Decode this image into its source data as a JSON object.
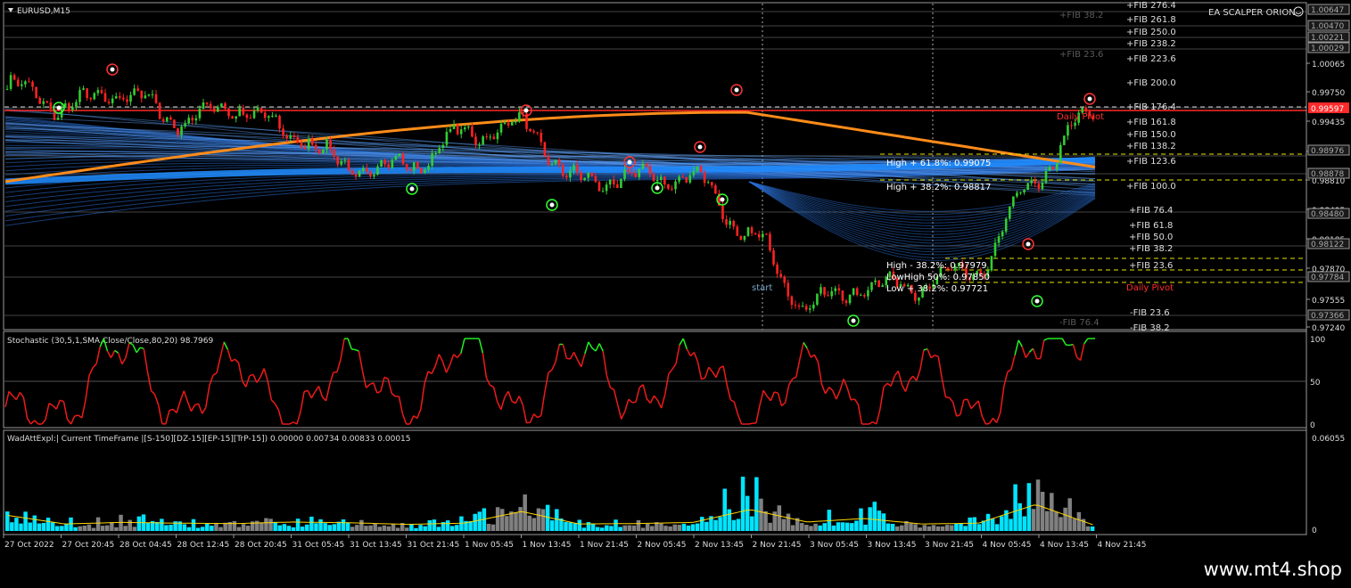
{
  "window": {
    "symbol_tf": "EURUSD,M15",
    "ea_name": "EA SCALPER ORION",
    "watermark": "www.mt4.shop"
  },
  "colors": {
    "background": "#000000",
    "grid": "#3a3a3a",
    "fan": "#2a6fd6",
    "orange_ma": "#ff8c1a",
    "bull_candle": "#32cd32",
    "bear_candle": "#ff2222",
    "stoch_high": "#22ee22",
    "stoch_low": "#ee1a1a",
    "wad_cyan": "#00e5ff",
    "wad_gray": "#808080",
    "wad_signal": "#ffd700",
    "pivot": "#ff2a2a",
    "fib_text": "#dddddd"
  },
  "main_chart": {
    "price_ticks": [
      "1.00065",
      "0.99750",
      "0.99435",
      "0.99125",
      "0.98810",
      "0.98495",
      "0.98185",
      "0.97870",
      "0.97555",
      "0.97240"
    ],
    "boxed_prices": [
      "1.00647",
      "1.00470",
      "1.00221",
      "1.00029",
      "0.98976",
      "0.98878",
      "0.98480",
      "0.98122",
      "0.97784",
      "0.97366"
    ],
    "current_price": "0.99597",
    "fib_right": [
      "+FIB 276.4",
      "+FIB 261.8",
      "+FIB 250.0",
      "+FIB 238.2",
      "+FIB 223.6",
      "+FIB 200.0",
      "+FIB 176.4",
      "+FIB 161.8",
      "+FIB 150.0",
      "+FIB 138.2",
      "+FIB 123.6",
      "+FIB 100.0",
      "+FIB 76.4",
      "+FIB 61.8",
      "+FIB 50.0",
      "+FIB 38.2",
      "+FIB 23.6",
      "-FIB 23.6",
      "-FIB 38.2"
    ],
    "fib_faded": [
      "+FIB 38.2",
      "+FIB 23.6",
      "-FIB 76.4"
    ],
    "level_labels": [
      "High + 61.8%: 0.99075",
      "High + 38.2%: 0.98817",
      "High - 38.2%: 0.97979",
      "LowHigh 50%: 0.97850",
      "Low + 38.2%: 0.97721"
    ],
    "pivot_labels": [
      "Daily Pivot",
      "Daily Pivot"
    ],
    "start_label": "start"
  },
  "time_axis": [
    "27 Oct 2022",
    "27 Oct 20:45",
    "28 Oct 04:45",
    "28 Oct 12:45",
    "28 Oct 20:45",
    "31 Oct 05:45",
    "31 Oct 13:45",
    "31 Oct 21:45",
    "1 Nov 05:45",
    "1 Nov 13:45",
    "1 Nov 21:45",
    "2 Nov 05:45",
    "2 Nov 13:45",
    "2 Nov 21:45",
    "3 Nov 05:45",
    "3 Nov 13:45",
    "3 Nov 21:45",
    "4 Nov 05:45",
    "4 Nov 13:45",
    "4 Nov 21:45"
  ],
  "stochastic": {
    "label": "Stochastic (30,5,1,SMA,Close/Close,80,20) 98.7969",
    "ticks": [
      "100",
      "50",
      "0"
    ]
  },
  "wad": {
    "label": "WadAttExpl:| Current TimeFrame |[S-150][DZ-15][EP-15][TrP-15]) 0.00000 0.00734 0.00833 0.00015",
    "ticks": [
      "0.06055",
      "0"
    ]
  },
  "chart_data": [
    {
      "type": "line",
      "title": "EURUSD,M15",
      "x": [
        "27 Oct 2022",
        "27 Oct 20:45",
        "28 Oct 04:45",
        "28 Oct 12:45",
        "28 Oct 20:45",
        "31 Oct 05:45",
        "31 Oct 13:45",
        "31 Oct 21:45",
        "1 Nov 05:45",
        "1 Nov 13:45",
        "1 Nov 21:45",
        "2 Nov 05:45",
        "2 Nov 13:45",
        "2 Nov 21:45",
        "3 Nov 05:45",
        "3 Nov 13:45",
        "3 Nov 21:45",
        "4 Nov 05:45",
        "4 Nov 13:45",
        "4 Nov 21:45"
      ],
      "series": [
        {
          "values": [
            0.9985,
            0.9962,
            0.9978,
            0.9948,
            0.9961,
            0.9932,
            0.9895,
            0.9897,
            0.9932,
            0.9941,
            0.988,
            0.9885,
            0.9885,
            0.982,
            0.9745,
            0.9765,
            0.9768,
            0.9785,
            0.9885,
            0.9958
          ]
        }
      ],
      "ylim": [
        0.9718,
        1.0075
      ]
    },
    {
      "type": "line",
      "title": "Stochastic (30,5,1,SMA,Close/Close,80,20) 98.7969",
      "x": [
        "27 Oct 2022",
        "27 Oct 20:45",
        "28 Oct 04:45",
        "28 Oct 12:45",
        "28 Oct 20:45",
        "31 Oct 05:45",
        "31 Oct 13:45",
        "31 Oct 21:45",
        "1 Nov 05:45",
        "1 Nov 13:45",
        "1 Nov 21:45",
        "2 Nov 05:45",
        "2 Nov 13:45",
        "2 Nov 21:45",
        "3 Nov 05:45",
        "3 Nov 13:45",
        "3 Nov 21:45",
        "4 Nov 05:45",
        "4 Nov 13:45",
        "4 Nov 21:45"
      ],
      "series": [
        {
          "values": [
            20,
            8,
            95,
            10,
            75,
            5,
            80,
            15,
            98,
            10,
            92,
            20,
            82,
            5,
            72,
            10,
            72,
            5,
            98,
            99
          ]
        }
      ],
      "ylim": [
        0,
        100
      ]
    },
    {
      "type": "bar",
      "title": "WadAttExpl:| Current TimeFrame |[S-150][DZ-15][EP-15][TrP-15]) 0.00000 0.00734 0.00833 0.00015",
      "categories": [
        "27 Oct 2022",
        "27 Oct 20:45",
        "28 Oct 04:45",
        "28 Oct 12:45",
        "28 Oct 20:45",
        "31 Oct 05:45",
        "31 Oct 13:45",
        "31 Oct 21:45",
        "1 Nov 05:45",
        "1 Nov 13:45",
        "1 Nov 21:45",
        "2 Nov 05:45",
        "2 Nov 13:45",
        "2 Nov 21:45",
        "3 Nov 05:45",
        "3 Nov 13:45",
        "3 Nov 21:45",
        "4 Nov 05:45",
        "4 Nov 13:45",
        "4 Nov 21:45"
      ],
      "series": [
        {
          "values": [
            0.03,
            0.008,
            0.012,
            0.01,
            0.009,
            0.013,
            0.011,
            0.007,
            0.01,
            0.04,
            0.008,
            0.009,
            0.012,
            0.045,
            0.013,
            0.022,
            0.008,
            0.01,
            0.058,
            0.006
          ]
        }
      ],
      "ylim": [
        0,
        0.06055
      ]
    }
  ]
}
